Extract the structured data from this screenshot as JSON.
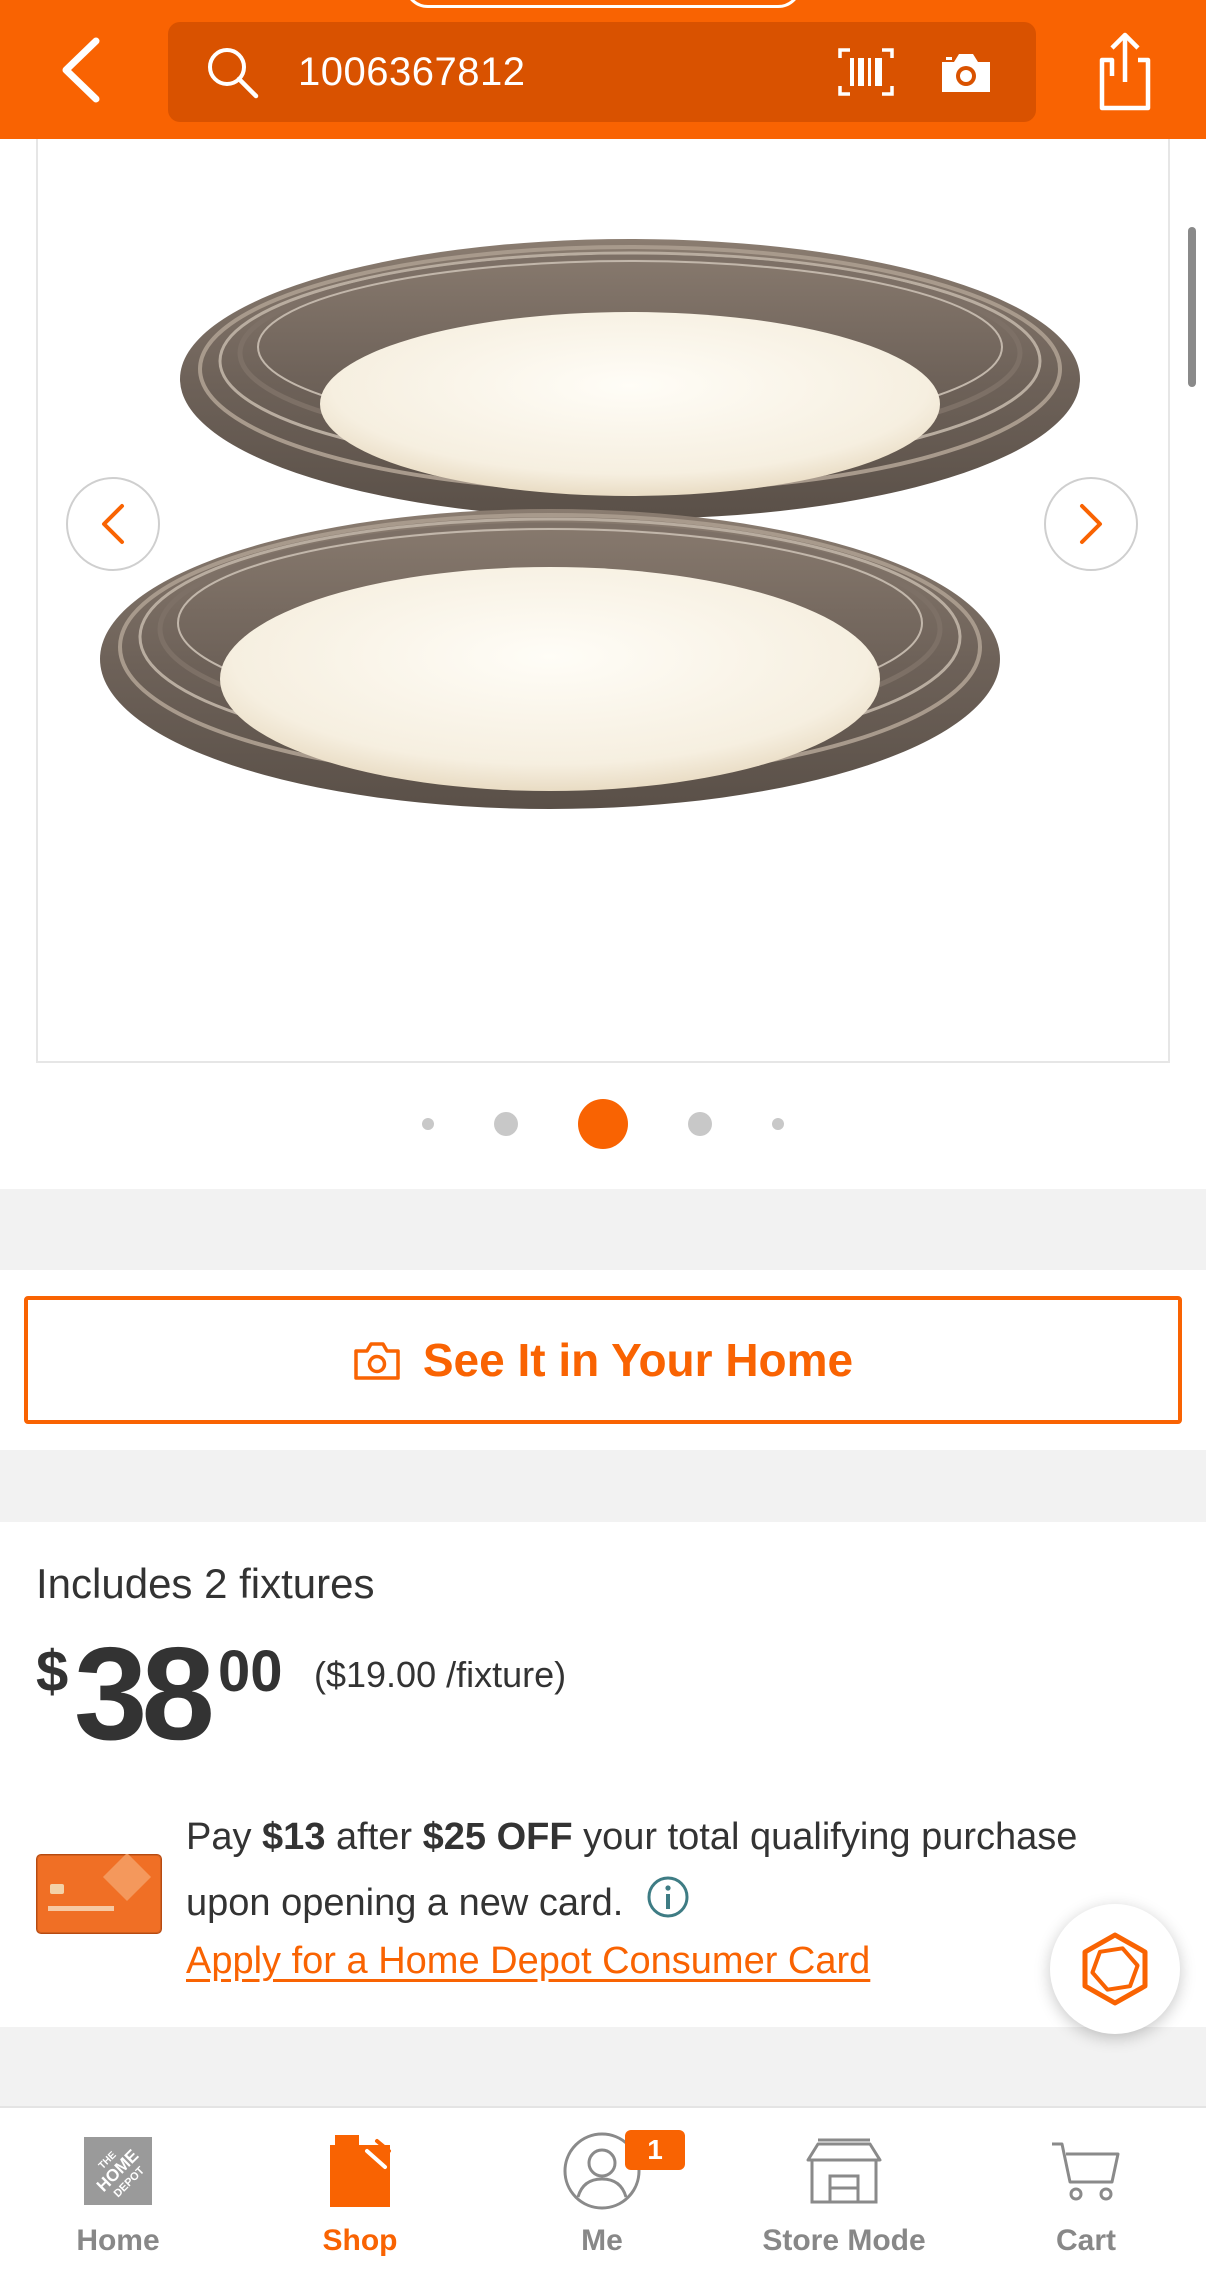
{
  "header": {
    "back_icon": "chevron-left-icon",
    "search": {
      "value": "1006367812",
      "icon": "search-icon"
    },
    "barcode_icon": "barcode-icon",
    "camera_icon": "camera-icon",
    "share_icon": "share-icon",
    "background_color": "#f96302"
  },
  "gallery": {
    "image": "two round ceiling light fixtures with weathered wood-tone frames",
    "prev_icon": "chevron-left-icon",
    "next_icon": "chevron-right-icon",
    "dot_count": 5,
    "active_dot": 3
  },
  "see_in_home": {
    "label": "See It in Your Home",
    "icon": "ar-camera-icon"
  },
  "pricing": {
    "includes": "Includes 2 fixtures",
    "currency": "$",
    "price_whole": "38",
    "price_cents": "00",
    "unit_price": "($19.00 /fixture)"
  },
  "promo": {
    "pay_prefix": "Pay",
    "pay_amount": "$13",
    "after": "after",
    "discount": "$25 OFF",
    "rest": "your total qualifying purchase upon opening a new card.",
    "apply_link": "Apply for a Home Depot Consumer Card",
    "info_icon": "info-icon"
  },
  "chat_icon": "chat-assistant-icon",
  "bottom_nav": {
    "items": [
      {
        "label": "Home",
        "icon": "home-depot-logo-icon",
        "active": false
      },
      {
        "label": "Shop",
        "icon": "shop-icon",
        "active": true
      },
      {
        "label": "Me",
        "icon": "user-icon",
        "badge": "1",
        "active": false
      },
      {
        "label": "Store Mode",
        "icon": "store-icon",
        "active": false
      },
      {
        "label": "Cart",
        "icon": "cart-icon",
        "active": false
      }
    ]
  },
  "colors": {
    "brand_orange": "#f96302",
    "search_bg": "#d95200",
    "text": "#333333",
    "inactive_nav": "#888888"
  }
}
